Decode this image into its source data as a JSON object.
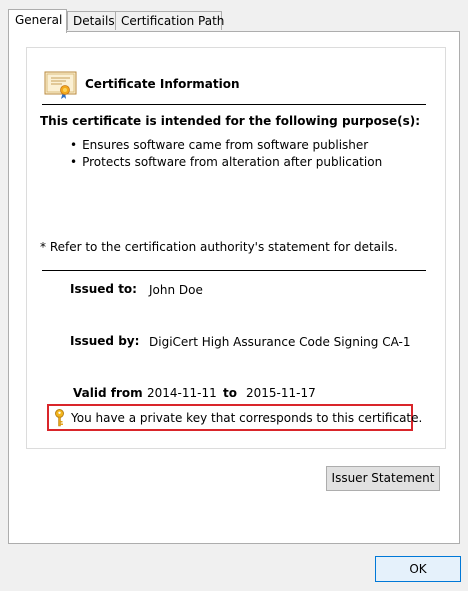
{
  "tabs": [
    {
      "label": "General",
      "active": true
    },
    {
      "label": "Details",
      "active": false
    },
    {
      "label": "Certification Path",
      "active": false
    }
  ],
  "general": {
    "info_title": "Certificate Information",
    "purpose_heading": "This certificate is intended for the following purpose(s):",
    "purposes": [
      "Ensures software came from software publisher",
      "Protects software from alteration after publication"
    ],
    "refer_note": "* Refer to the certification authority's statement for details.",
    "issued_to_label": "Issued to:",
    "issued_to_value": "John Doe",
    "issued_by_label": "Issued by:",
    "issued_by_value": "DigiCert High Assurance Code Signing CA-1",
    "valid_from_label": "Valid from",
    "valid_from_value": "2014-11-11",
    "valid_to_label": "to",
    "valid_to_value": "2015-11-17",
    "private_key_note": "You have a private key that corresponds to this certificate."
  },
  "buttons": {
    "issuer_statement": "Issuer Statement",
    "ok": "OK"
  },
  "colors": {
    "highlight_border": "#d9252a",
    "ok_border": "#0078d7"
  }
}
